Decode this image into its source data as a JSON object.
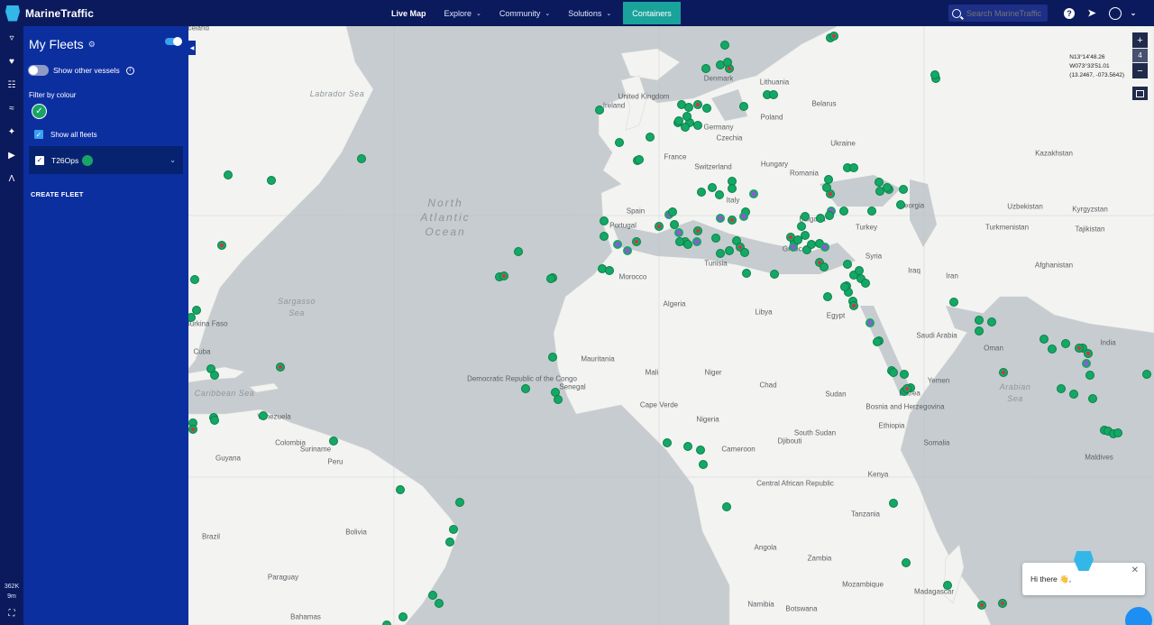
{
  "brand": {
    "name": "MarineTraffic"
  },
  "nav": {
    "items": [
      {
        "label": "Live Map",
        "active": true,
        "has_menu": false
      },
      {
        "label": "Explore",
        "active": false,
        "has_menu": true
      },
      {
        "label": "Community",
        "active": false,
        "has_menu": true
      },
      {
        "label": "Solutions",
        "active": false,
        "has_menu": true
      }
    ],
    "containers": "Containers"
  },
  "search": {
    "placeholder": "Search MarineTraffic"
  },
  "panel": {
    "title": "My Fleets",
    "show_other_vessels": "Show other vessels",
    "filter_by_colour": "Filter by colour",
    "show_all_fleets": "Show all fleets",
    "fleet_name": "T26Ops",
    "create_fleet": "CREATE FLEET"
  },
  "rail_stats": {
    "vessels": "362K",
    "time": "9m"
  },
  "map": {
    "zoom_level": "4",
    "coords": {
      "lat": "N13°14'48.26",
      "lon": "W073°33'51.01",
      "decimal": "(13.2467, -073.5642)"
    },
    "labels": [
      {
        "text": "Labrador Sea",
        "type": "sea"
      },
      {
        "text": "Sargasso",
        "type": "sea"
      },
      {
        "text": "Sea",
        "type": "sea"
      },
      {
        "text": "Caribbean Sea",
        "type": "sea"
      },
      {
        "text": "Arabian",
        "type": "sea"
      },
      {
        "text": "Sea",
        "type": "sea"
      },
      {
        "text": "Iceland",
        "type": "country"
      },
      {
        "text": "Ireland",
        "type": "country"
      },
      {
        "text": "United Kingdom",
        "type": "country"
      },
      {
        "text": "Denmark",
        "type": "country"
      },
      {
        "text": "Lithuania",
        "type": "country"
      },
      {
        "text": "Belarus",
        "type": "country"
      },
      {
        "text": "Poland",
        "type": "country"
      },
      {
        "text": "Germany",
        "type": "country"
      },
      {
        "text": "Czechia",
        "type": "country"
      },
      {
        "text": "Ukraine",
        "type": "country"
      },
      {
        "text": "France",
        "type": "country"
      },
      {
        "text": "Switzerland",
        "type": "country"
      },
      {
        "text": "Hungary",
        "type": "country"
      },
      {
        "text": "Romania",
        "type": "country"
      },
      {
        "text": "Italy",
        "type": "country"
      },
      {
        "text": "Spain",
        "type": "country"
      },
      {
        "text": "Portugal",
        "type": "country"
      },
      {
        "text": "Bulgaria",
        "type": "country"
      },
      {
        "text": "Greece",
        "type": "country"
      },
      {
        "text": "Turkey",
        "type": "country"
      },
      {
        "text": "Georgia",
        "type": "country"
      },
      {
        "text": "Kazakhstan",
        "type": "country"
      },
      {
        "text": "Uzbekistan",
        "type": "country"
      },
      {
        "text": "Kyrgyzstan",
        "type": "country"
      },
      {
        "text": "Turkmenistan",
        "type": "country"
      },
      {
        "text": "Tajikistan",
        "type": "country"
      },
      {
        "text": "Afghanistan",
        "type": "country"
      },
      {
        "text": "Iran",
        "type": "country"
      },
      {
        "text": "Iraq",
        "type": "country"
      },
      {
        "text": "Syria",
        "type": "country"
      },
      {
        "text": "Tunisia",
        "type": "country"
      },
      {
        "text": "Morocco",
        "type": "country"
      },
      {
        "text": "Algeria",
        "type": "country"
      },
      {
        "text": "Libya",
        "type": "country"
      },
      {
        "text": "Egypt",
        "type": "country"
      },
      {
        "text": "Saudi Arabia",
        "type": "country"
      },
      {
        "text": "Oman",
        "type": "country"
      },
      {
        "text": "Yemen",
        "type": "country"
      },
      {
        "text": "India",
        "type": "country"
      },
      {
        "text": "Mauritania",
        "type": "country"
      },
      {
        "text": "Mali",
        "type": "country"
      },
      {
        "text": "Niger",
        "type": "country"
      },
      {
        "text": "Chad",
        "type": "country"
      },
      {
        "text": "Sudan",
        "type": "country"
      },
      {
        "text": "Eritrea",
        "type": "country"
      },
      {
        "text": "Ethiopia",
        "type": "country"
      },
      {
        "text": "Somalia",
        "type": "country"
      },
      {
        "text": "Senegal",
        "type": "country"
      },
      {
        "text": "Nigeria",
        "type": "country"
      },
      {
        "text": "Cameroon",
        "type": "country"
      },
      {
        "text": "South Sudan",
        "type": "country"
      },
      {
        "text": "Kenya",
        "type": "country"
      },
      {
        "text": "Tanzania",
        "type": "country"
      },
      {
        "text": "Angola",
        "type": "country"
      },
      {
        "text": "Zambia",
        "type": "country"
      },
      {
        "text": "Mozambique",
        "type": "country"
      },
      {
        "text": "Madagascar",
        "type": "country"
      },
      {
        "text": "Namibia",
        "type": "country"
      },
      {
        "text": "Botswana",
        "type": "country"
      },
      {
        "text": "Maldives",
        "type": "country"
      },
      {
        "text": "Cuba",
        "type": "country"
      },
      {
        "text": "Venezuela",
        "type": "country"
      },
      {
        "text": "Colombia",
        "type": "country"
      },
      {
        "text": "Guyana",
        "type": "country"
      },
      {
        "text": "Suriname",
        "type": "country"
      },
      {
        "text": "Peru",
        "type": "country"
      },
      {
        "text": "Brazil",
        "type": "country"
      },
      {
        "text": "Bolivia",
        "type": "country"
      },
      {
        "text": "Paraguay",
        "type": "country"
      },
      {
        "text": "Bahamas",
        "type": "country"
      },
      {
        "text": "Burkina Faso",
        "type": "country"
      },
      {
        "text": "Cape Verde",
        "type": "country"
      },
      {
        "text": "Democratic Republic of the Congo",
        "type": "country"
      },
      {
        "text": "Central African Republic",
        "type": "country"
      },
      {
        "text": "Djibouti",
        "type": "country"
      },
      {
        "text": "Bosnia and Herzegovina",
        "type": "country"
      }
    ],
    "ocean_lines": [
      "North",
      "Atlantic",
      "Ocean"
    ]
  },
  "chat": {
    "greeting": "Hi there 👋,"
  },
  "colors": {
    "topbar": "#0b1a5c",
    "panel": "#0c2fa0",
    "vessel": "#14a865",
    "accent": "#1aa39a"
  }
}
